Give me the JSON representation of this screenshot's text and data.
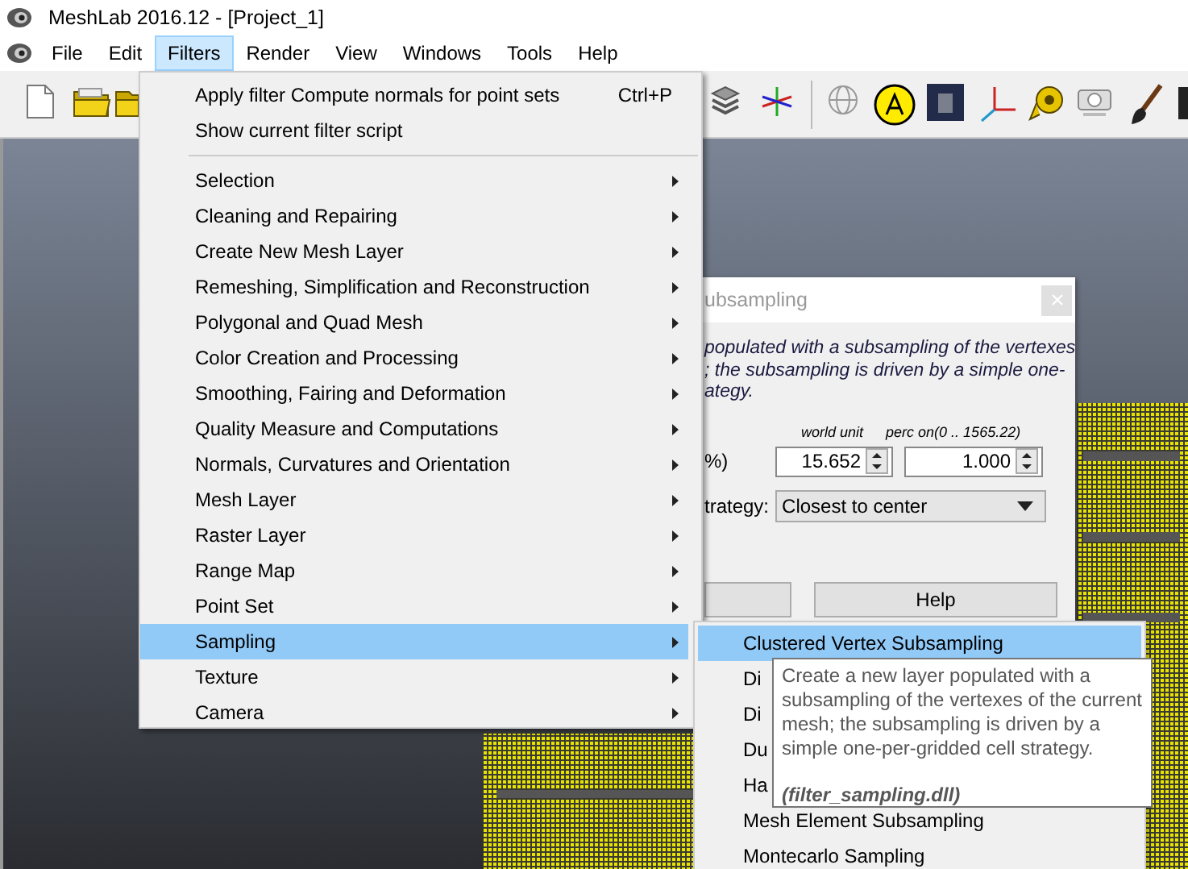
{
  "window": {
    "title": "MeshLab 2016.12 - [Project_1]"
  },
  "menubar": [
    {
      "label": "File",
      "selected": false
    },
    {
      "label": "Edit",
      "selected": false
    },
    {
      "label": "Filters",
      "selected": true
    },
    {
      "label": "Render",
      "selected": false
    },
    {
      "label": "View",
      "selected": false
    },
    {
      "label": "Windows",
      "selected": false
    },
    {
      "label": "Tools",
      "selected": false
    },
    {
      "label": "Help",
      "selected": false
    }
  ],
  "filters_menu": {
    "items": [
      {
        "kind": "action",
        "label": "Apply filter Compute normals for point sets",
        "shortcut": "Ctrl+P",
        "selected": false
      },
      {
        "kind": "action",
        "label": "Show current filter script",
        "selected": false
      },
      {
        "kind": "submenu",
        "label": "Selection",
        "selected": false
      },
      {
        "kind": "submenu",
        "label": "Cleaning and Repairing",
        "selected": false
      },
      {
        "kind": "submenu",
        "label": "Create New Mesh Layer",
        "selected": false
      },
      {
        "kind": "submenu",
        "label": "Remeshing, Simplification and Reconstruction",
        "selected": false
      },
      {
        "kind": "submenu",
        "label": "Polygonal and Quad Mesh",
        "selected": false
      },
      {
        "kind": "submenu",
        "label": "Color Creation and Processing",
        "selected": false
      },
      {
        "kind": "submenu",
        "label": "Smoothing, Fairing and Deformation",
        "selected": false
      },
      {
        "kind": "submenu",
        "label": "Quality Measure and Computations",
        "selected": false
      },
      {
        "kind": "submenu",
        "label": "Normals, Curvatures and Orientation",
        "selected": false
      },
      {
        "kind": "submenu",
        "label": "Mesh Layer",
        "selected": false
      },
      {
        "kind": "submenu",
        "label": "Raster Layer",
        "selected": false
      },
      {
        "kind": "submenu",
        "label": "Range Map",
        "selected": false
      },
      {
        "kind": "submenu",
        "label": "Point Set",
        "selected": false
      },
      {
        "kind": "submenu",
        "label": "Sampling",
        "selected": true
      },
      {
        "kind": "submenu",
        "label": "Texture",
        "selected": false
      },
      {
        "kind": "submenu",
        "label": "Camera",
        "selected": false
      }
    ]
  },
  "sampling_submenu": {
    "items": [
      {
        "label": "Clustered Vertex Subsampling",
        "selected": true
      },
      {
        "label": "Di",
        "selected": false
      },
      {
        "label": "Di",
        "selected": false
      },
      {
        "label": "Du",
        "selected": false
      },
      {
        "label": "Ha",
        "selected": false
      },
      {
        "label": "Mesh Element Subsampling",
        "selected": false
      },
      {
        "label": "Montecarlo Sampling",
        "selected": false
      }
    ]
  },
  "tooltip": {
    "text": "Create a new layer populated with a subsampling of the vertexes of the current mesh; the subsampling is driven by a simple one-per-gridded cell strategy.",
    "source": "(filter_sampling.dll)"
  },
  "dialog": {
    "title": "ubsampling",
    "description_lines": [
      "populated with a subsampling of the vertexes",
      "; the subsampling is driven by a simple one-",
      "ategy."
    ],
    "column_labels": [
      "world unit",
      "perc on(0 .. 1565.22)"
    ],
    "param_label": "%)",
    "values": [
      "15.652",
      "1.000"
    ],
    "strategy_label": "trategy:",
    "strategy_value": "Closest to center",
    "help_button": "Help"
  }
}
